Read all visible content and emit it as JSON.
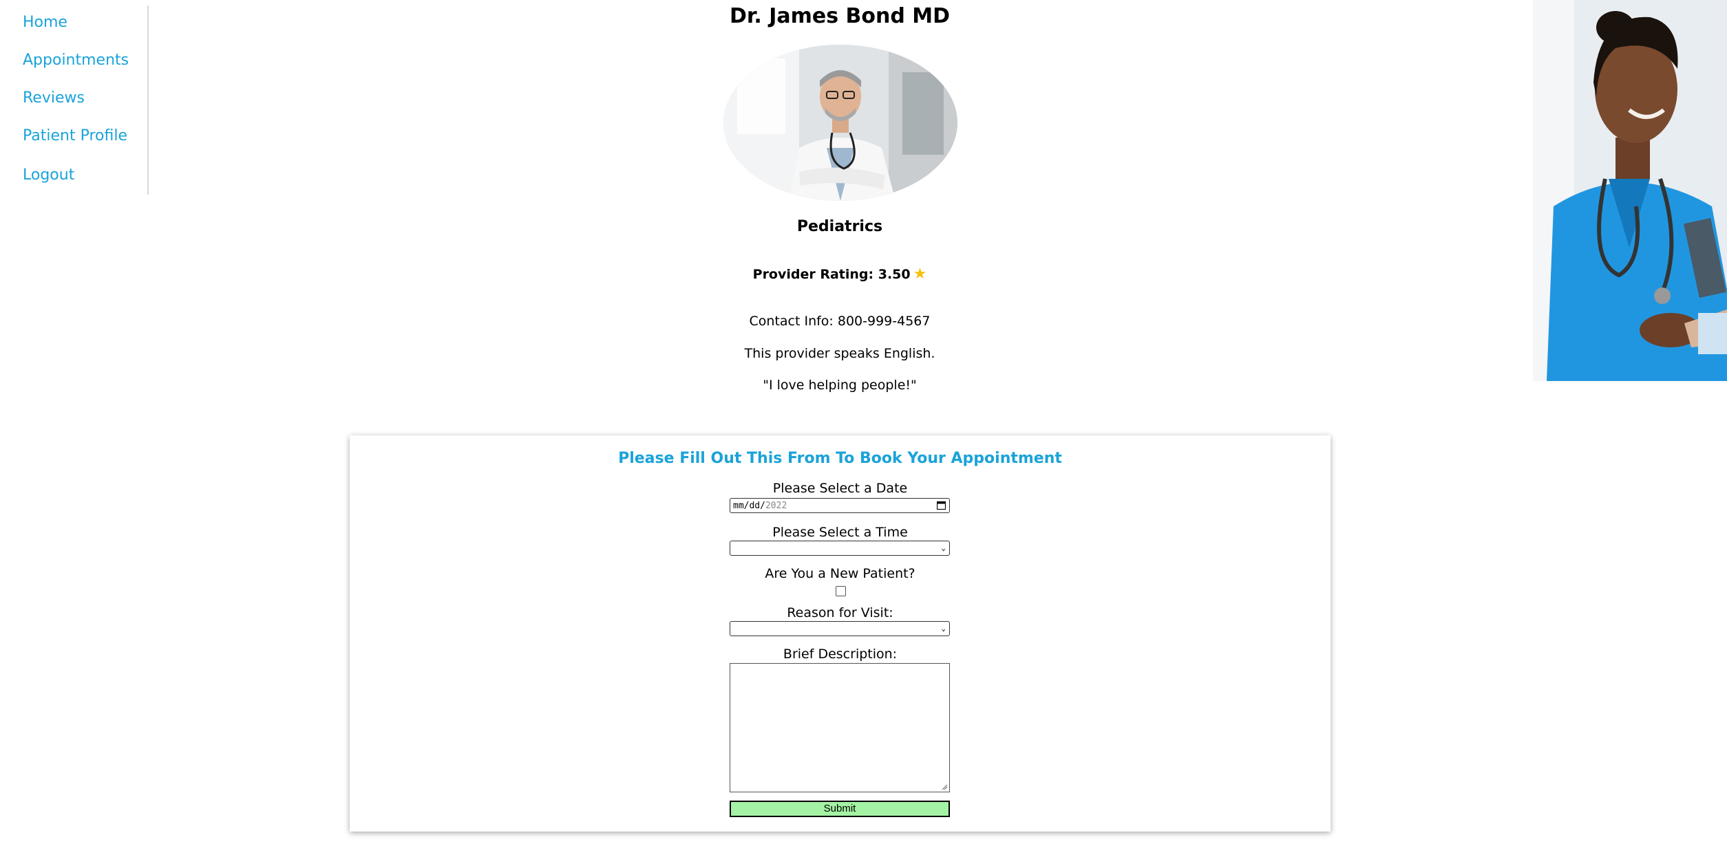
{
  "sidebar": {
    "items": [
      {
        "label": "Home"
      },
      {
        "label": "Appointments"
      },
      {
        "label": "Reviews"
      },
      {
        "label": "Patient Profile"
      },
      {
        "label": "Logout"
      }
    ]
  },
  "provider": {
    "name": "Dr. James Bond MD",
    "specialty": "Pediatrics",
    "rating_label": "Provider Rating: 3.50",
    "contact": "Contact Info: 800-999-4567",
    "language": "This provider speaks English.",
    "quote": "\"I love helping people!\""
  },
  "form": {
    "title": "Please Fill Out This From To Book Your Appointment",
    "date_label": "Please Select a Date",
    "date_value_mmdd": "mm/dd/",
    "date_value_year": "2022",
    "time_label": "Please Select a Time",
    "new_patient_label": "Are You a New Patient?",
    "reason_label": "Reason for Visit:",
    "description_label": "Brief Description:",
    "submit_label": "Submit"
  },
  "colors": {
    "accent": "#1aa3d9",
    "submit_bg": "#a4f2a4",
    "star": "#f4c20d"
  },
  "icons": {
    "rating": "star-icon",
    "date": "calendar-icon",
    "select": "chevron-down-icon"
  }
}
